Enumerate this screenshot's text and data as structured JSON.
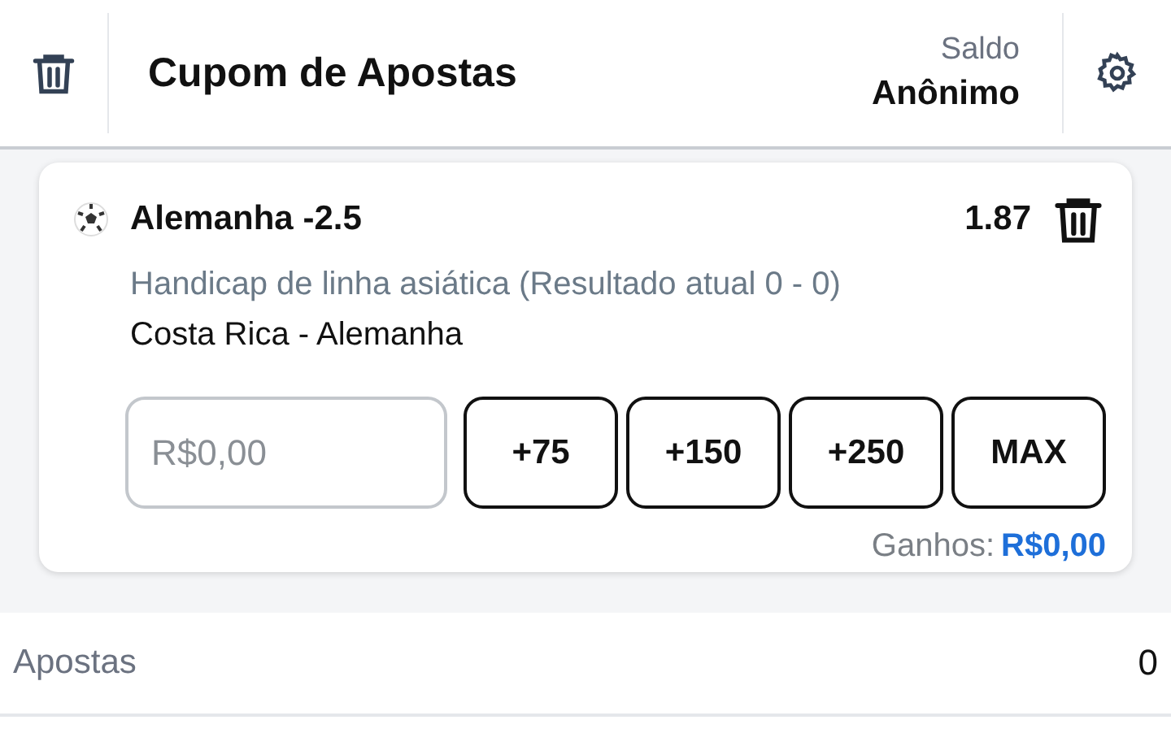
{
  "header": {
    "title": "Cupom de Apostas",
    "balance_label": "Saldo",
    "balance_value": "Anônimo"
  },
  "bets": [
    {
      "selection": "Alemanha -2.5",
      "odds": "1.87",
      "market": "Handicap de linha asiática (Resultado atual 0 - 0)",
      "event": "Costa Rica - Alemanha",
      "stake": {
        "placeholder": "R$0,00"
      },
      "quick_stakes": [
        "+75",
        "+150",
        "+250",
        "MAX"
      ],
      "winnings_label": "Ganhos:",
      "winnings_value": "R$0,00"
    }
  ],
  "summary": {
    "label": "Apostas",
    "value": "0"
  }
}
